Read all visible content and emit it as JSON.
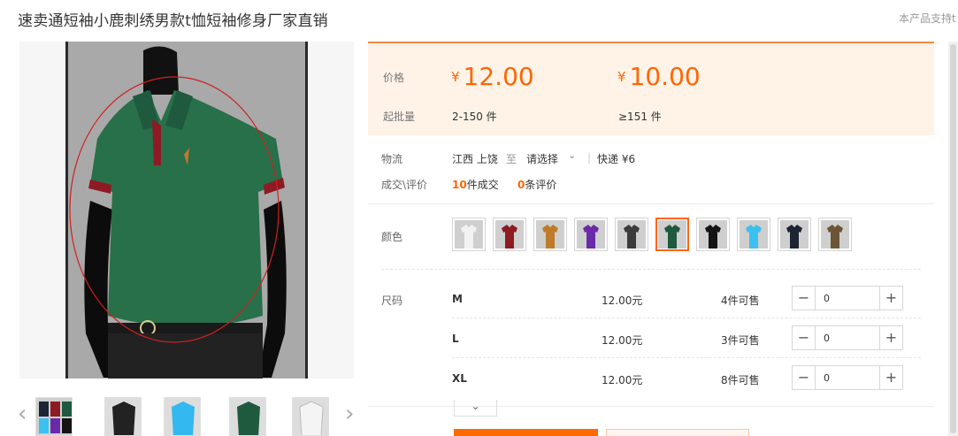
{
  "product": {
    "title": "速卖通短袖小鹿刺绣男款t恤短袖修身厂家直销",
    "support_text": "本产品支持t"
  },
  "pricing": {
    "price_label": "价格",
    "currency": "¥",
    "tiers": [
      {
        "price": "12.00",
        "range": "2-150 件"
      },
      {
        "price": "10.00",
        "range": "≥151 件"
      }
    ],
    "moq_label": "起批量"
  },
  "logistics": {
    "label": "物流",
    "origin": "江西 上饶",
    "to": "至",
    "destination": "请选择",
    "express": "快递 ¥6"
  },
  "sales": {
    "label": "成交\\评价",
    "deals_count": "10",
    "deals_suffix": "件成交",
    "reviews_count": "0",
    "reviews_suffix": "条评价"
  },
  "colors": {
    "label": "颜色",
    "selected_index": 5,
    "swatches": [
      "#f2f2f2",
      "#8e1a24",
      "#c07a2a",
      "#6a2aa8",
      "#3b3b3b",
      "#1f5a3e",
      "#141414",
      "#3cc0f0",
      "#1d2433",
      "#6b5536"
    ]
  },
  "sizes": {
    "label": "尺码",
    "rows": [
      {
        "name": "M",
        "price": "12.00元",
        "stock": "4件可售",
        "qty": "0"
      },
      {
        "name": "L",
        "price": "12.00元",
        "stock": "3件可售",
        "qty": "0"
      },
      {
        "name": "XL",
        "price": "12.00元",
        "stock": "8件可售",
        "qty": "0"
      }
    ]
  },
  "gallery": {
    "thumb_colors": [
      "#2a4a36",
      "#222222",
      "#33b8ef",
      "#1f5a3e",
      "#f4f4f4"
    ]
  }
}
